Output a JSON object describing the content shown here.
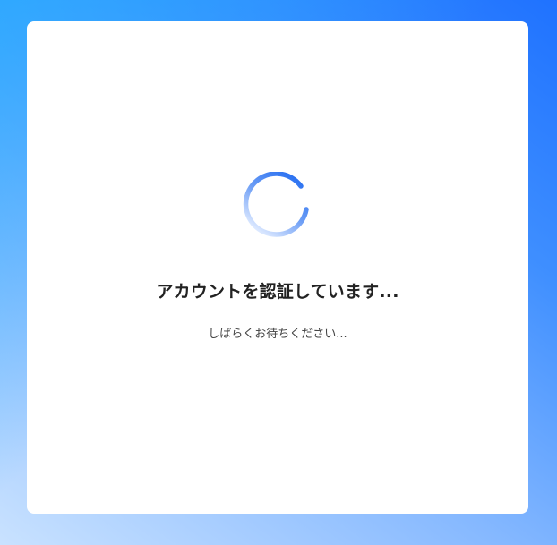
{
  "status": {
    "title": "アカウントを認証しています...",
    "subtitle": "しばらくお待ちください..."
  },
  "colors": {
    "spinner_start": "#1a66f0",
    "spinner_end": "#dbe8ff",
    "background_top_right": "#1f72ff",
    "background_bottom_left": "#c9e2ff"
  },
  "icons": {
    "spinner": "loading-spinner-icon"
  }
}
